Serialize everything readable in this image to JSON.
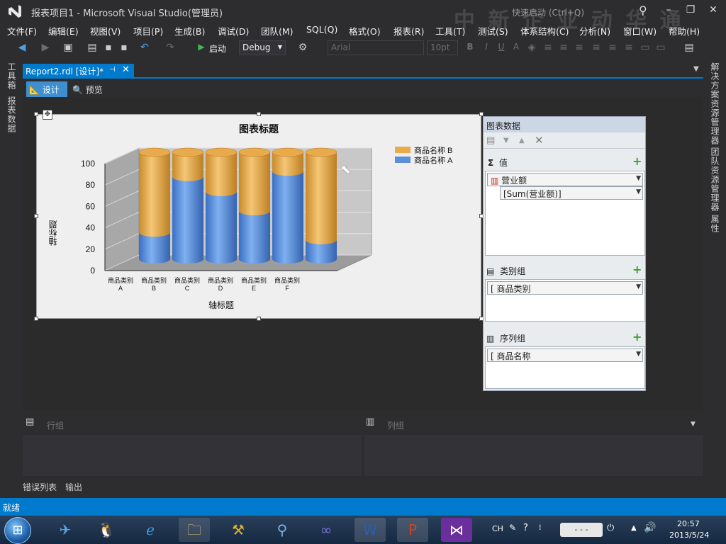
{
  "window": {
    "title": "报表项目1 - Microsoft Visual Studio(管理员)",
    "quick_launch": "快速启动 (Ctrl+Q)",
    "watermark": "中 新 企 业 动 华 通"
  },
  "menu": [
    "文件(F)",
    "编辑(E)",
    "视图(V)",
    "项目(P)",
    "生成(B)",
    "调试(D)",
    "团队(M)",
    "SQL(Q)",
    "格式(O)",
    "报表(R)",
    "工具(T)",
    "测试(S)",
    "体系结构(C)",
    "分析(N)",
    "窗口(W)",
    "帮助(H)"
  ],
  "toolbar": {
    "start_label": "启动",
    "config": "Debug",
    "font_family": "Arial",
    "font_size": "10pt",
    "bold": "B",
    "italic": "I",
    "underline": "U"
  },
  "left_tabs": {
    "toolbox": "工具箱",
    "report_data": "报表数据"
  },
  "right_tabs": {
    "solution_explorer": "解决方案资源管理器",
    "team_explorer": "团队资源管理器",
    "properties": "属性"
  },
  "document": {
    "tab_label": "Report2.rdl [设计]*",
    "pin_icon": "pin-icon",
    "close_icon": "close-icon",
    "design_label": "设计",
    "preview_label": "预览"
  },
  "chart_data": {
    "type": "bar",
    "title": "图表标题",
    "xlabel": "轴标题",
    "ylabel": "轴标题",
    "ylim": [
      0,
      100
    ],
    "yticks": [
      "0",
      "20",
      "40",
      "60",
      "80",
      "100"
    ],
    "categories": [
      "商品类别A",
      "商品类别B",
      "商品类别C",
      "商品类别D",
      "商品类别E",
      "商品类别F"
    ],
    "category_lines": [
      [
        "商品类别",
        "A"
      ],
      [
        "商品类别",
        "B"
      ],
      [
        "商品类别",
        "C"
      ],
      [
        "商品类别",
        "D"
      ],
      [
        "商品类别",
        "E"
      ],
      [
        "商品类别",
        "F"
      ]
    ],
    "series": [
      {
        "name": "商品名称 A",
        "color": "#5b8fd9",
        "values": [
          25,
          77,
          63,
          45,
          82,
          18
        ]
      },
      {
        "name": "商品名称 B",
        "color": "#e9aa4c",
        "values": [
          75,
          23,
          37,
          55,
          18,
          82
        ]
      }
    ],
    "legend_order": [
      "商品名称 B",
      "商品名称 A"
    ],
    "stacked": true,
    "style": "3d-cylinder",
    "legend_position": "top-right"
  },
  "chart_panel": {
    "title": "图表数据",
    "values_label": "值",
    "value_field": "营业额",
    "value_expr": "[Sum(营业额)]",
    "category_label": "类别组",
    "category_field": "商品类别",
    "series_label": "序列组",
    "series_field": "商品名称"
  },
  "groups": {
    "row_label": "行组",
    "col_label": "列组"
  },
  "bottom_tabs": [
    "错误列表",
    "输出"
  ],
  "status": "就绪",
  "tray": {
    "lang": "CH",
    "time": "20:57",
    "date": "2013/5/24",
    "input": "- - -"
  }
}
